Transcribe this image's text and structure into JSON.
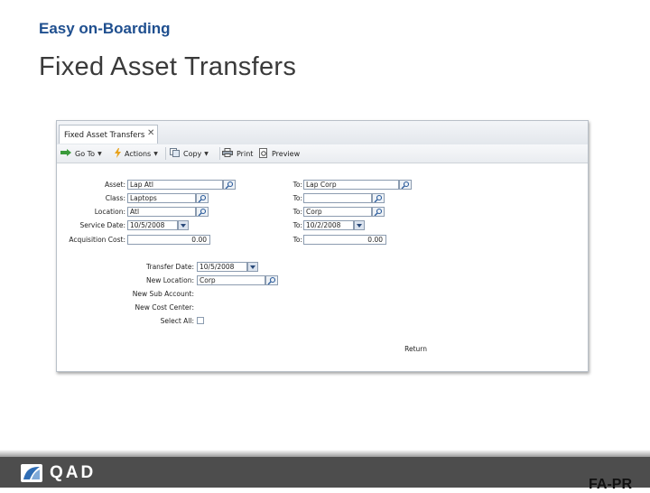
{
  "header": {
    "kicker": "Easy on-Boarding",
    "title": "Fixed Asset Transfers"
  },
  "window": {
    "tab_label": "Fixed Asset Transfers"
  },
  "toolbar": {
    "goto": "Go To",
    "actions": "Actions",
    "copy": "Copy",
    "print": "Print",
    "preview": "Preview"
  },
  "form": {
    "asset": {
      "label": "Asset:",
      "value": "Lap Atl",
      "to_label": "To:",
      "to_value": "Lap Corp"
    },
    "class": {
      "label": "Class:",
      "value": "Laptops",
      "to_label": "To:",
      "to_value": ""
    },
    "location": {
      "label": "Location:",
      "value": "Atl",
      "to_label": "To:",
      "to_value": "Corp"
    },
    "service_date": {
      "label": "Service Date:",
      "value": "10/5/2008",
      "to_label": "To:",
      "to_value": "10/2/2008"
    },
    "acquisition_cost": {
      "label": "Acquisition Cost:",
      "value": "0.00",
      "to_label": "To:",
      "to_value": "0.00"
    },
    "transfer_date": {
      "label": "Transfer Date:",
      "value": "10/5/2008"
    },
    "new_location": {
      "label": "New Location:",
      "value": "Corp"
    },
    "new_sub_account": {
      "label": "New Sub Account:"
    },
    "new_cost_center": {
      "label": "New Cost Center:"
    },
    "select_all": {
      "label": "Select All:",
      "checked": false
    },
    "button": "Return"
  },
  "footer": {
    "brand": "QAD",
    "slide_code": "FA-PR"
  },
  "colors": {
    "kicker": "#1f4f8f",
    "title": "#3a3a3a",
    "footer": "#4d4d4d",
    "field_border": "#8c9cb0"
  }
}
